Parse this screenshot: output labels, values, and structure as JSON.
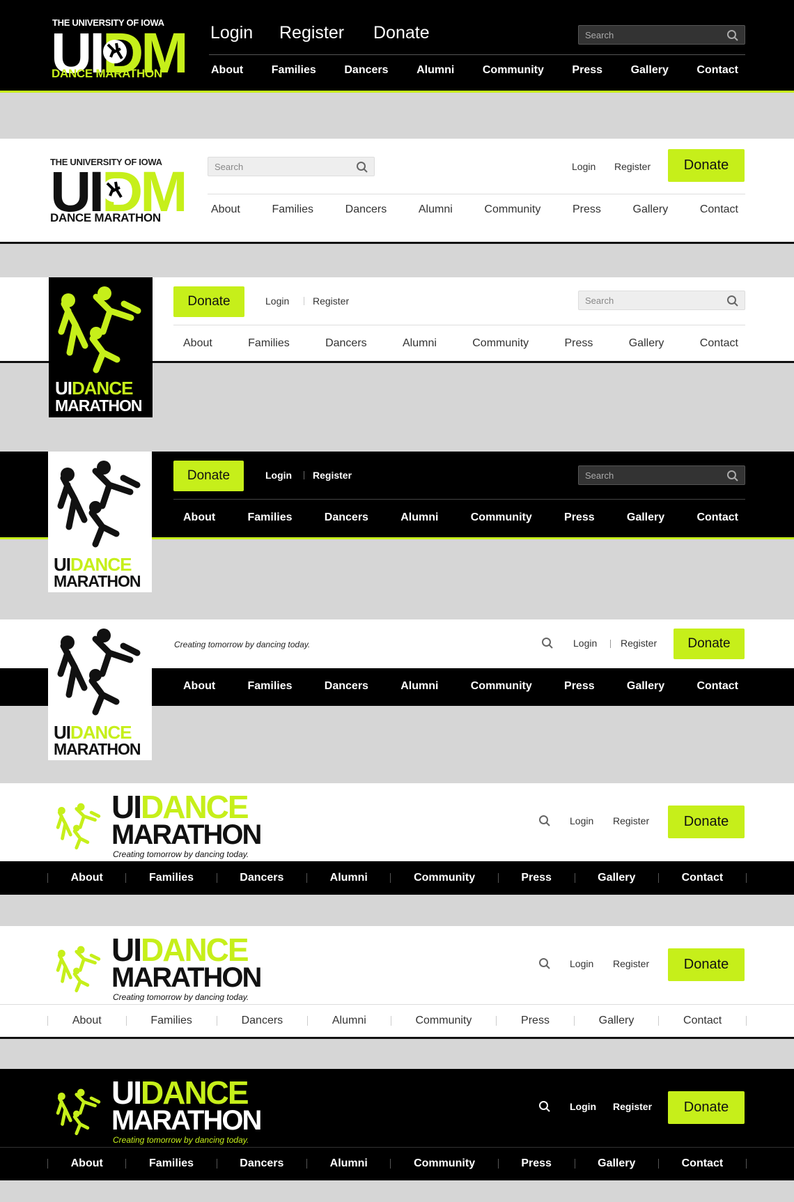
{
  "brand": {
    "university": "THE UNIVERSITY OF IOWA",
    "uidm_ui": "UI",
    "uidm_dm": "DM",
    "dance_marathon": "DANCE MARATHON",
    "ui": "UI",
    "dance": "DANCE",
    "marathon": "MARATHON",
    "tagline": "Creating tomorrow by dancing today."
  },
  "actions": {
    "login": "Login",
    "register": "Register",
    "donate": "Donate"
  },
  "search": {
    "placeholder": "Search"
  },
  "nav": [
    "About",
    "Families",
    "Dancers",
    "Alumni",
    "Community",
    "Press",
    "Gallery",
    "Contact"
  ],
  "colors": {
    "accent": "#c6ef1a",
    "dark": "#000000",
    "light": "#ffffff",
    "background": "#d6d6d6"
  }
}
